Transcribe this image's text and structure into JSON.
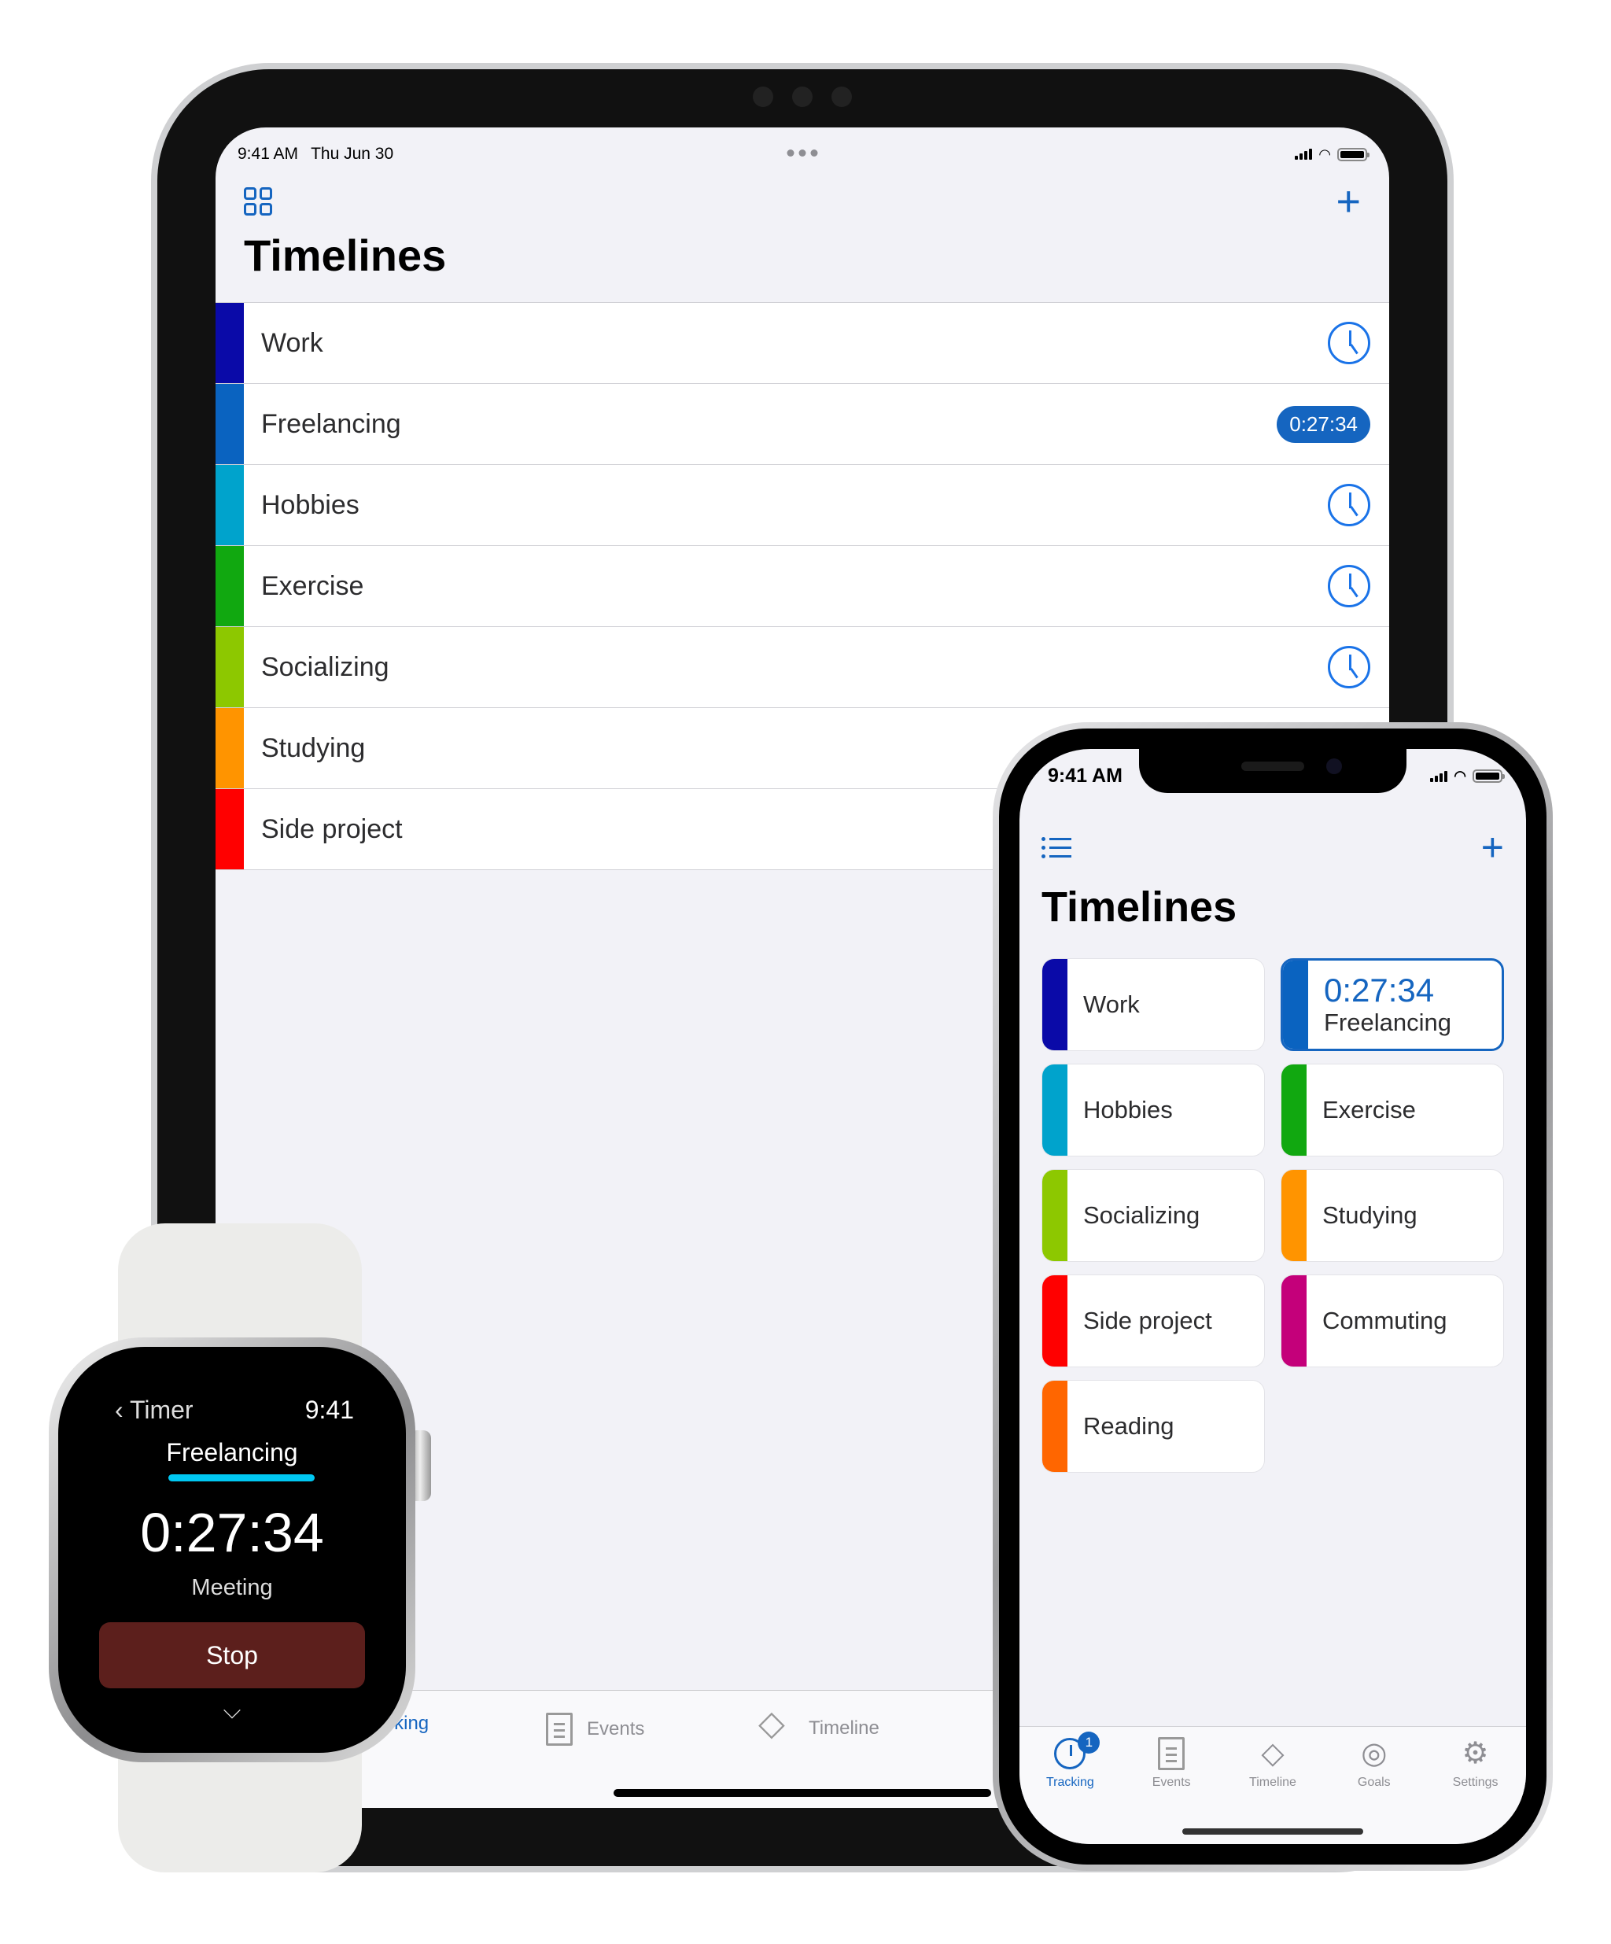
{
  "ipad": {
    "status": {
      "time": "9:41 AM",
      "date": "Thu Jun 30"
    },
    "title": "Timelines",
    "rows": [
      {
        "label": "Work",
        "color": "#0a0aa8",
        "state": "idle"
      },
      {
        "label": "Freelancing",
        "color": "#0a63c0",
        "state": "running",
        "timer": "0:27:34"
      },
      {
        "label": "Hobbies",
        "color": "#00a3cc",
        "state": "idle"
      },
      {
        "label": "Exercise",
        "color": "#11a810",
        "state": "idle"
      },
      {
        "label": "Socializing",
        "color": "#8dc800",
        "state": "idle"
      },
      {
        "label": "Studying",
        "color": "#ff9400",
        "state": "idle"
      },
      {
        "label": "Side project",
        "color": "#ff0000",
        "state": "idle"
      }
    ],
    "tabs": [
      {
        "label": "Tracking",
        "active": true
      },
      {
        "label": "Events",
        "active": false
      },
      {
        "label": "Timeline",
        "active": false
      }
    ]
  },
  "iphone": {
    "status": {
      "time": "9:41 AM"
    },
    "title": "Timelines",
    "tiles": [
      {
        "label": "Work",
        "color": "#0a0aa8"
      },
      {
        "label": "Freelancing",
        "color": "#0a63c0",
        "timer": "0:27:34",
        "active": true
      },
      {
        "label": "Hobbies",
        "color": "#00a3cc"
      },
      {
        "label": "Exercise",
        "color": "#11a810"
      },
      {
        "label": "Socializing",
        "color": "#8dc800"
      },
      {
        "label": "Studying",
        "color": "#ff9400"
      },
      {
        "label": "Side project",
        "color": "#ff0000"
      },
      {
        "label": "Commuting",
        "color": "#c4007a"
      },
      {
        "label": "Reading",
        "color": "#ff6600"
      }
    ],
    "tabs": [
      {
        "label": "Tracking",
        "icon": "clock-icon",
        "badge": "1",
        "active": true
      },
      {
        "label": "Events",
        "icon": "document-icon"
      },
      {
        "label": "Timeline",
        "icon": "fan-icon"
      },
      {
        "label": "Goals",
        "icon": "target-icon"
      },
      {
        "label": "Settings",
        "icon": "gear-icon"
      }
    ]
  },
  "watch": {
    "back_label": "Timer",
    "time": "9:41",
    "timeline": "Freelancing",
    "timer": "0:27:34",
    "activity": "Meeting",
    "stop_label": "Stop"
  },
  "colors": {
    "accent": "#1565c0",
    "watch_stop": "#5c1f1c",
    "watch_underline": "#00c7f2"
  }
}
